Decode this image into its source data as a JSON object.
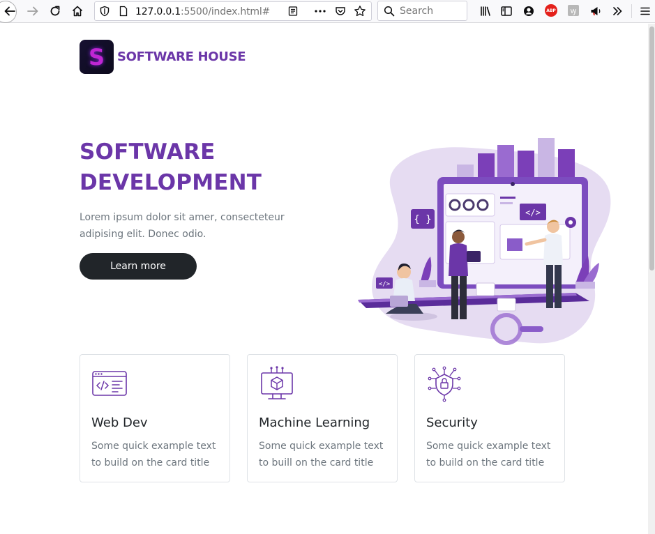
{
  "browser": {
    "url_host": "127.0.0.1",
    "url_rest": ":5500/index.html#",
    "search_placeholder": "Search",
    "extension_abp": "ABP"
  },
  "site": {
    "brand_letter": "S",
    "brand_name": "SOFTWARE HOUSE"
  },
  "hero": {
    "title_line1": "SOFTWARE",
    "title_line2": "DEVELOPMENT",
    "text_line1": "Lorem ipsum dolor sit amer, consecteteur",
    "text_line2": "adipising elit. Donec odio.",
    "button_label": "Learn more"
  },
  "cards": [
    {
      "title": "Web Dev",
      "text_line1": "Some quick example text",
      "text_line2": "to build on the card title",
      "icon": "web-code-icon"
    },
    {
      "title": "Machine Learning",
      "text_line1": "Some quick example text",
      "text_line2": "to buill on the card title",
      "icon": "machine-learning-icon"
    },
    {
      "title": "Security",
      "text_line1": "Some quick example text",
      "text_line2": "to build on the card title",
      "icon": "security-lock-icon"
    }
  ],
  "colors": {
    "brand_purple": "#6b36a8",
    "button_dark": "#212529",
    "muted_text": "#6c757d"
  }
}
